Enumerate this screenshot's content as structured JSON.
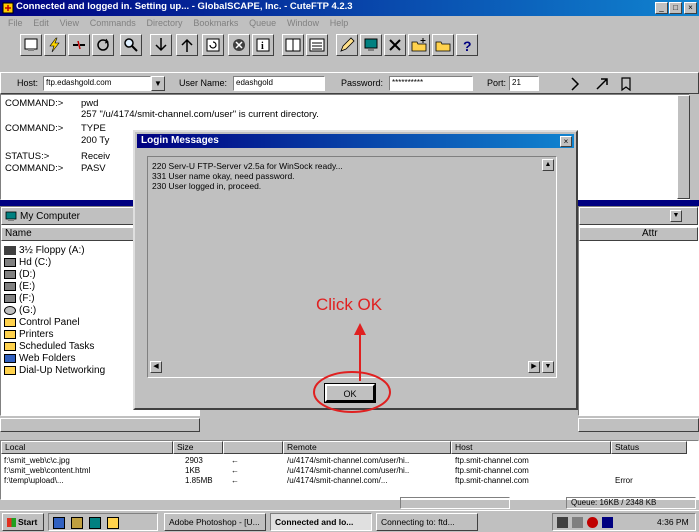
{
  "window": {
    "title": "Connected and logged in. Setting up... - GlobalSCAPE, Inc. - CuteFTP 4.2.3"
  },
  "menu": [
    "File",
    "Edit",
    "View",
    "Commands",
    "Directory",
    "Bookmarks",
    "Queue",
    "Window",
    "Help"
  ],
  "connection": {
    "host_label": "Host:",
    "host_value": "ftp.edashgold.com",
    "user_label": "User Name:",
    "user_value": "edashgold",
    "password_label": "Password:",
    "password_value": "**********",
    "port_label": "Port:",
    "port_value": "21"
  },
  "log": [
    {
      "k": "COMMAND:>",
      "v": "pwd"
    },
    {
      "k": "",
      "v": "257 \"/u/4174/smit-channel.com/user\" is current directory."
    },
    {
      "k": "COMMAND:>",
      "v": "TYPE"
    },
    {
      "k": "",
      "v": "200 Ty"
    },
    {
      "k": "STATUS:>",
      "v": "Receiv"
    },
    {
      "k": "COMMAND:>",
      "v": "PASV"
    }
  ],
  "local": {
    "path": "My Computer",
    "col_name": "Name",
    "items": [
      "3½ Floppy (A:)",
      "Hd (C:)",
      "(D:)",
      "(E:)",
      "(F:)",
      "(G:)",
      "Control Panel",
      "Printers",
      "Scheduled Tasks",
      "Web Folders",
      "Dial-Up Networking"
    ]
  },
  "remote": {
    "col_attr": "Attr"
  },
  "queue": {
    "headers": [
      "Local",
      "Size",
      "",
      "Remote",
      "Host",
      "Status"
    ],
    "rows": [
      [
        "f:\\smit_web\\c\\c.jpg",
        "2903",
        "←",
        "/u/4174/smit-channel.com/user/hi..",
        "ftp.smit-channel.com",
        ""
      ],
      [
        "f:\\smit_web\\content.html",
        "1KB",
        "←",
        "/u/4174/smit-channel.com/user/hi..",
        "ftp.smit-channel.com",
        ""
      ],
      [
        "f:\\temp\\upload\\...",
        "1.85MB",
        "←",
        "/u/4174/smit-channel.com/...",
        "ftp.smit-channel.com",
        "Error"
      ]
    ]
  },
  "status": {
    "queue": "Queue: 16KB / 2348 KB"
  },
  "taskbar": {
    "start": "Start",
    "items": [
      "Adobe Photoshop - [U...",
      "Connected and lo...",
      "Connecting to: ftd..."
    ],
    "clock": "4:36 PM"
  },
  "dialog": {
    "title": "Login Messages",
    "lines": [
      "220 Serv-U FTP-Server v2.5a for WinSock ready...",
      "331 User name okay, need password.",
      "230 User logged in, proceed."
    ],
    "ok_label": "OK",
    "annotation": "Click OK"
  }
}
